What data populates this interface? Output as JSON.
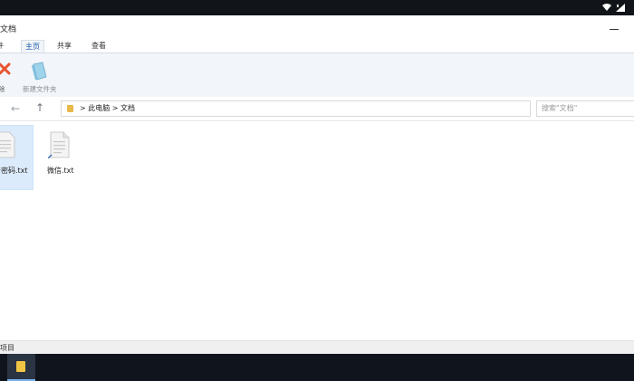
{
  "window": {
    "title": "文档",
    "minimize_glyph": "—"
  },
  "ribbon": {
    "tabs": [
      {
        "label": "件"
      },
      {
        "label": "主页"
      },
      {
        "label": "共享"
      },
      {
        "label": "查看"
      }
    ],
    "active_tab": "主页",
    "buttons": {
      "delete_label": "除",
      "new_folder_label": "新建文件夹"
    }
  },
  "nav": {
    "back_glyph": "←",
    "up_glyph": "↑",
    "address_path": "> 此电脑 > 文档",
    "search_placeholder": "搜索\"文档\""
  },
  "files": [
    {
      "name": "号密码.txt",
      "selected": true
    },
    {
      "name": "微信.txt",
      "selected": false
    }
  ],
  "status": {
    "text": "项目"
  },
  "icons": {
    "wifi": "wifi-icon",
    "signal": "signal-icon",
    "delete": "delete-x-icon",
    "new_folder": "new-folder-icon",
    "file": "text-file-icon",
    "address_folder": "folder-icon",
    "taskbar_explorer": "file-explorer-icon"
  },
  "colors": {
    "accent": "#1e5aa8",
    "selection": "#dcebfb",
    "taskbar": "#10151d",
    "delete_red": "#e8532f",
    "folder_yellow": "#f0c544"
  }
}
